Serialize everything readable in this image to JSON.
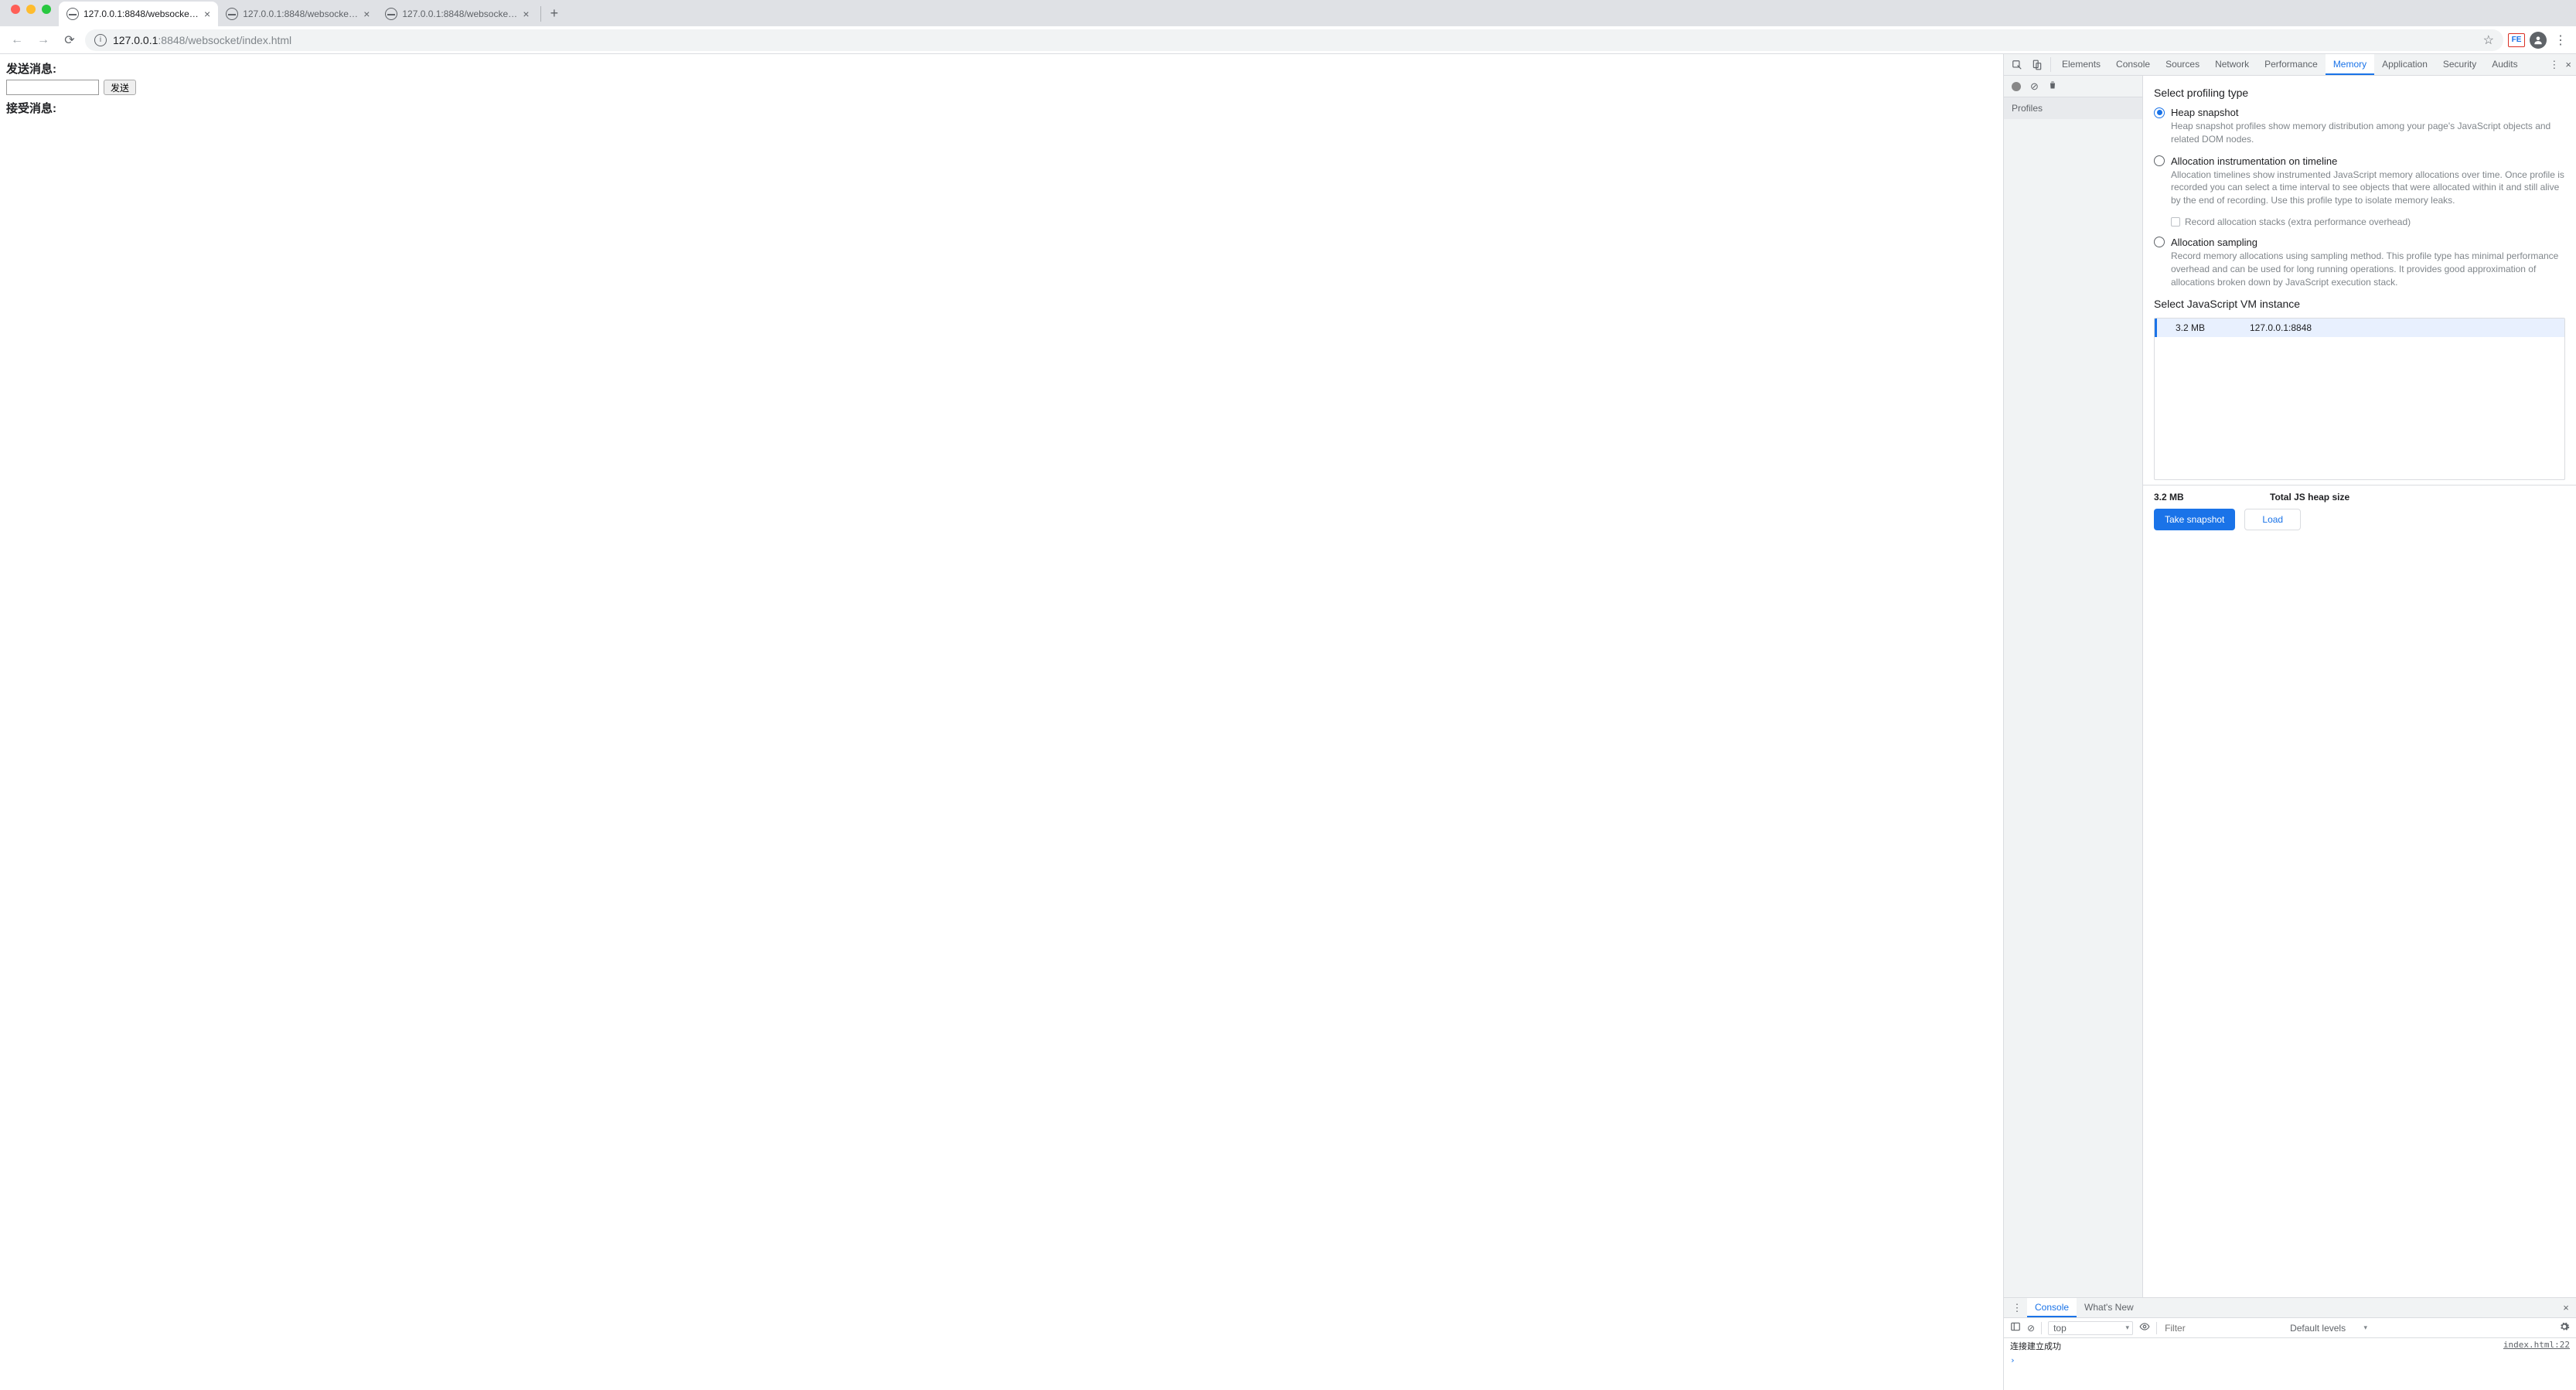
{
  "chrome": {
    "tabs": [
      {
        "title": "127.0.0.1:8848/websocket/inde",
        "active": true
      },
      {
        "title": "127.0.0.1:8848/websocket/inde",
        "active": false
      },
      {
        "title": "127.0.0.1:8848/websocket/inde",
        "active": false
      }
    ],
    "url_host": "127.0.0.1",
    "url_port_path": ":8848/websocket/index.html",
    "ext_label": "FE"
  },
  "page": {
    "send_label": "发送消息:",
    "recv_label": "接受消息:",
    "send_btn": "发送",
    "input_value": ""
  },
  "devtools": {
    "tabs": {
      "elements": "Elements",
      "console": "Console",
      "sources": "Sources",
      "network": "Network",
      "performance": "Performance",
      "memory": "Memory",
      "application": "Application",
      "security": "Security",
      "audits": "Audits"
    },
    "profiles_label": "Profiles",
    "heading_type": "Select profiling type",
    "opt1_title": "Heap snapshot",
    "opt1_desc": "Heap snapshot profiles show memory distribution among your page's JavaScript objects and related DOM nodes.",
    "opt2_title": "Allocation instrumentation on timeline",
    "opt2_desc": "Allocation timelines show instrumented JavaScript memory allocations over time. Once profile is recorded you can select a time interval to see objects that were allocated within it and still alive by the end of recording. Use this profile type to isolate memory leaks.",
    "opt2_check": "Record allocation stacks (extra performance overhead)",
    "opt3_title": "Allocation sampling",
    "opt3_desc": "Record memory allocations using sampling method. This profile type has minimal performance overhead and can be used for long running operations. It provides good approximation of allocations broken down by JavaScript execution stack.",
    "heading_vm": "Select JavaScript VM instance",
    "vm_row": {
      "size": "3.2 MB",
      "host": "127.0.0.1:8848"
    },
    "footer": {
      "size": "3.2 MB",
      "label": "Total JS heap size"
    },
    "btn_take": "Take snapshot",
    "btn_load": "Load"
  },
  "drawer": {
    "tab_console": "Console",
    "tab_whats_new": "What's New",
    "context": "top",
    "filter_placeholder": "Filter",
    "levels": "Default levels",
    "log_msg": "连接建立成功",
    "log_src": "index.html:22",
    "prompt": "›"
  }
}
